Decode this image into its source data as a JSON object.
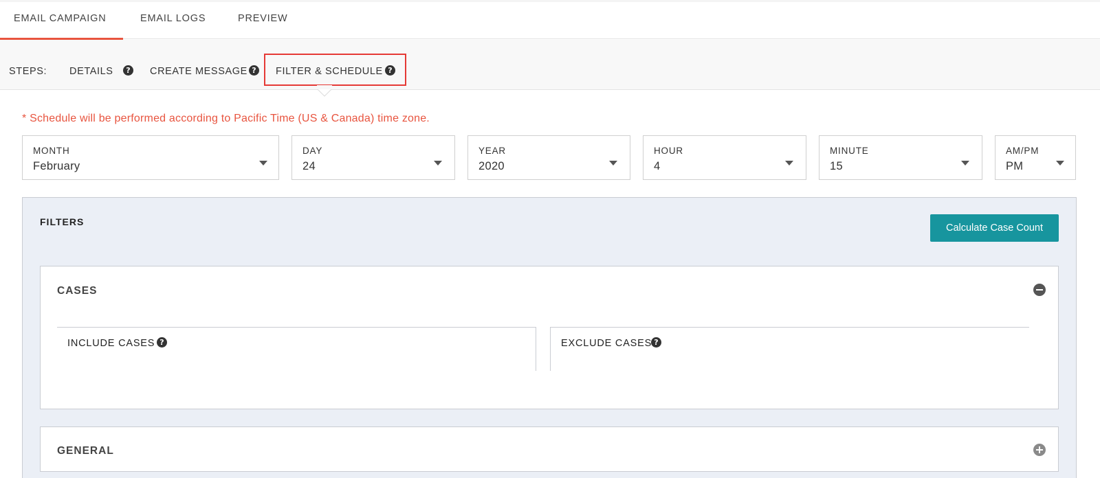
{
  "tabs": [
    {
      "label": "EMAIL CAMPAIGN",
      "active": true
    },
    {
      "label": "EMAIL LOGS",
      "active": false
    },
    {
      "label": "PREVIEW",
      "active": false
    }
  ],
  "steps": {
    "label": "STEPS:",
    "items": [
      {
        "label": "DETAILS",
        "help_icon": "question-circle-icon"
      },
      {
        "label": "CREATE MESSAGE",
        "help_icon": "question-circle-icon"
      },
      {
        "label": "FILTER & SCHEDULE",
        "help_icon": "question-circle-icon",
        "active": true
      }
    ],
    "help_glyph": "?"
  },
  "notice": "* Schedule will be performed according to Pacific Time (US & Canada) time zone.",
  "schedule": {
    "month": {
      "label": "MONTH",
      "value": "February"
    },
    "day": {
      "label": "DAY",
      "value": "24"
    },
    "year": {
      "label": "YEAR",
      "value": "2020"
    },
    "hour": {
      "label": "HOUR",
      "value": "4"
    },
    "minute": {
      "label": "MINUTE",
      "value": "15"
    },
    "ampm": {
      "label": "AM/PM",
      "value": "PM"
    }
  },
  "filters": {
    "title": "FILTERS",
    "calculate_button": "Calculate Case Count",
    "cases": {
      "title": "CASES",
      "include_label": "INCLUDE CASES",
      "exclude_label": "EXCLUDE CASES",
      "toggle_icon": "minus-circle-icon"
    },
    "general": {
      "title": "GENERAL",
      "toggle_icon": "plus-circle-icon"
    }
  },
  "colors": {
    "accent": "#e8543f",
    "button": "#17959e",
    "highlight": "#e53935",
    "panel_bg": "#ebeff6"
  }
}
